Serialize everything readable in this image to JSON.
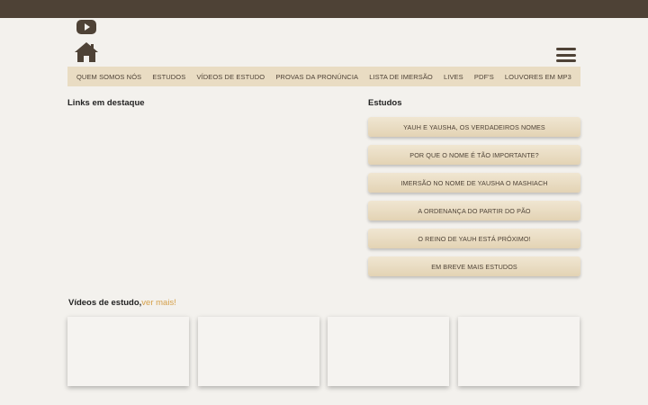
{
  "nav": {
    "items": [
      {
        "label": "QUEM SOMOS NÓS"
      },
      {
        "label": "ESTUDOS"
      },
      {
        "label": "VÍDEOS DE ESTUDO"
      },
      {
        "label": "PROVAS DA PRONÚNCIA"
      },
      {
        "label": "LISTA DE IMERSÃO"
      },
      {
        "label": "LIVES"
      },
      {
        "label": "PDF'S"
      },
      {
        "label": "LOUVORES EM MP3"
      }
    ]
  },
  "featured": {
    "title": "Links em destaque"
  },
  "studies": {
    "title": "Estudos",
    "items": [
      {
        "label": "YAUH E YAUSHA, OS VERDADEIROS NOMES"
      },
      {
        "label": "POR QUE O NOME É TÃO IMPORTANTE?"
      },
      {
        "label": "IMERSÃO NO NOME DE YAUSHA O MASHIACH"
      },
      {
        "label": "A ORDENANÇA DO PARTIR DO PÃO"
      },
      {
        "label": "O REINO DE YAUH ESTÁ PRÓXIMO!"
      },
      {
        "label": "EM BREVE MAIS ESTUDOS"
      }
    ]
  },
  "videos": {
    "title": "Vídeos de estudo,",
    "more": "ver mais!"
  },
  "colors": {
    "brown": "#4e4236",
    "nav_bg": "#e9dcc3",
    "accent": "#d5a04a",
    "background": "#f3f1ed"
  }
}
